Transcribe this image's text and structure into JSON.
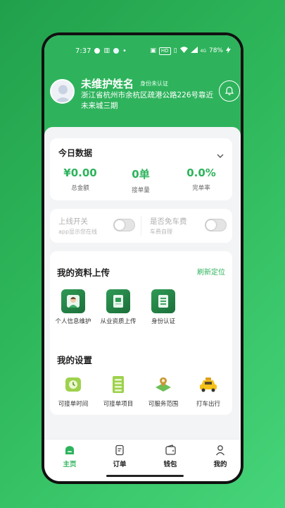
{
  "status_bar": {
    "time": "7:37",
    "network_badge": "HD",
    "battery": "78%",
    "signal_label": "4G"
  },
  "profile": {
    "name": "未维护姓名",
    "cert_status": "身份未认证",
    "address": "浙江省杭州市余杭区疏港公路226号靠近未来城三期"
  },
  "today": {
    "title": "今日数据",
    "stats": [
      {
        "value": "¥0.00",
        "label": "总金额"
      },
      {
        "value": "0单",
        "label": "接单量"
      },
      {
        "value": "0.0%",
        "label": "完单率"
      }
    ]
  },
  "switches": {
    "online": {
      "title": "上线开关",
      "subtitle": "app显示您在线"
    },
    "free_fee": {
      "title": "是否免车费",
      "subtitle": "车费自理"
    }
  },
  "materials": {
    "title": "我的资料上传",
    "refresh": "刷新定位",
    "items": [
      {
        "label": "个人信息维护",
        "icon": "person-icon"
      },
      {
        "label": "从业资质上传",
        "icon": "certificate-icon"
      },
      {
        "label": "身份认证",
        "icon": "id-card-icon"
      }
    ]
  },
  "settings": {
    "title": "我的设置",
    "items": [
      {
        "label": "可接单时间",
        "icon": "clock-icon"
      },
      {
        "label": "可接单项目",
        "icon": "list-icon"
      },
      {
        "label": "可服务范围",
        "icon": "map-pin-icon"
      },
      {
        "label": "打车出行",
        "icon": "taxi-icon"
      }
    ]
  },
  "tabbar": {
    "tabs": [
      {
        "label": "主页",
        "icon": "home-icon",
        "active": true
      },
      {
        "label": "订单",
        "icon": "order-icon",
        "active": false
      },
      {
        "label": "钱包",
        "icon": "wallet-icon",
        "active": false
      },
      {
        "label": "我的",
        "icon": "user-icon",
        "active": false
      }
    ]
  },
  "colors": {
    "primary": "#2eb35c",
    "background": "#f3f4f6"
  }
}
